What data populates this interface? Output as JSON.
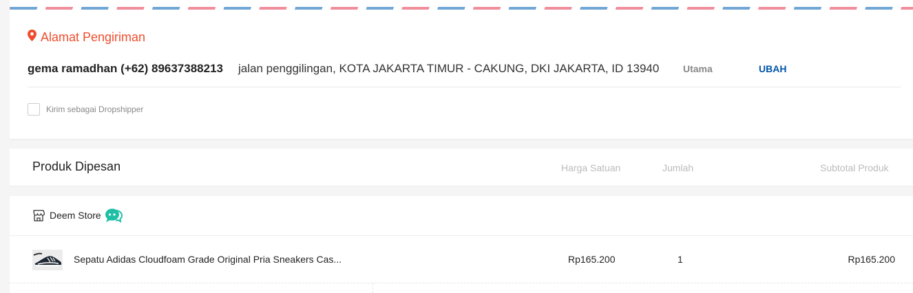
{
  "address": {
    "title": "Alamat Pengiriman",
    "recipient": "gema ramadhan (+62) 89637388213",
    "detail": "jalan penggilingan, KOTA JAKARTA TIMUR - CAKUNG, DKI JAKARTA, ID 13940",
    "badge": "Utama",
    "change_label": "UBAH",
    "dropshipper_label": "Kirim sebagai Dropshipper",
    "dropshipper_checked": false,
    "accent_color": "#ee4d2d",
    "link_color": "#0055aa"
  },
  "products": {
    "title": "Produk Dipesan",
    "columns": {
      "price": "Harga Satuan",
      "qty": "Jumlah",
      "subtotal": "Subtotal Produk"
    }
  },
  "order": {
    "store_name": "Deem Store",
    "store_icon": "store-icon",
    "chat_icon": "chat-icon",
    "items": [
      {
        "name": "Sepatu Adidas Cloudfoam Grade Original Pria Sneakers Cas...",
        "price": "Rp165.200",
        "qty": "1",
        "subtotal": "Rp165.200"
      }
    ]
  }
}
